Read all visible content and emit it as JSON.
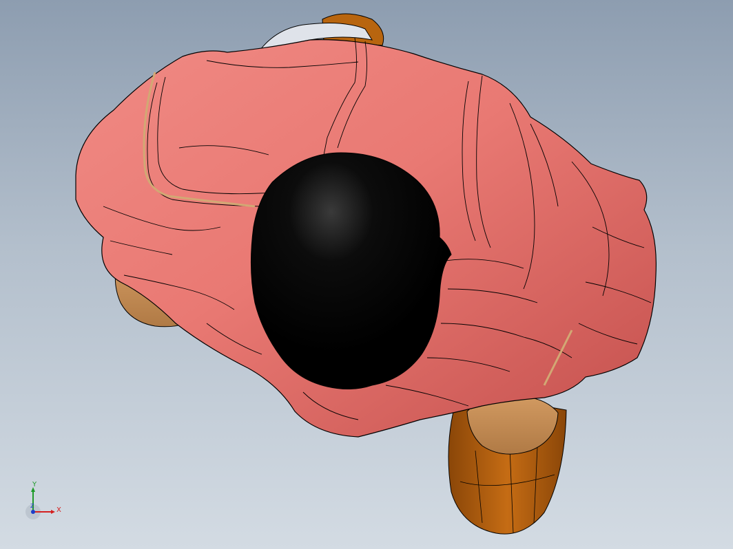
{
  "viewport": {
    "background_top": "#8d9db0",
    "background_bottom": "#d3dbe3"
  },
  "model": {
    "jacket_color": "#e77570",
    "jacket_shadow_color": "#b94a48",
    "hair_color": "#000000",
    "skin_color": "#c68c55",
    "shoe_color": "#b8650f",
    "edge_color": "#000000"
  },
  "triad": {
    "x_label": "X",
    "y_label": "Y",
    "z_label": "Z",
    "x_color": "#d42020",
    "y_color": "#1f9a2a",
    "z_color": "#1c3fc8"
  }
}
